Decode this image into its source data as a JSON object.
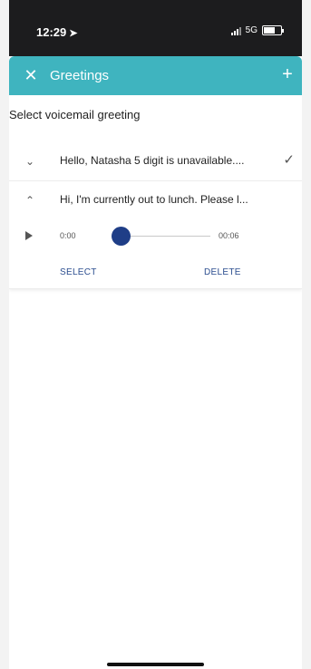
{
  "status_bar": {
    "time": "12:29",
    "network": "5G"
  },
  "header": {
    "title": "Greetings",
    "close_symbol": "✕",
    "add_symbol": "+"
  },
  "section_title": "Select voicemail greeting",
  "greetings": [
    {
      "text": "Hello, Natasha 5 digit is unavailable....",
      "selected": true,
      "expanded": false
    },
    {
      "text": "Hi, I'm currently out to lunch. Please l...",
      "selected": false,
      "expanded": true
    }
  ],
  "player": {
    "current_time": "0:00",
    "duration": "00:06",
    "progress": 0
  },
  "actions": {
    "select_label": "SELECT",
    "delete_label": "DELETE"
  },
  "colors": {
    "header": "#3fb4bf",
    "accent": "#1f3e87",
    "action_text": "#2b4d8f"
  }
}
